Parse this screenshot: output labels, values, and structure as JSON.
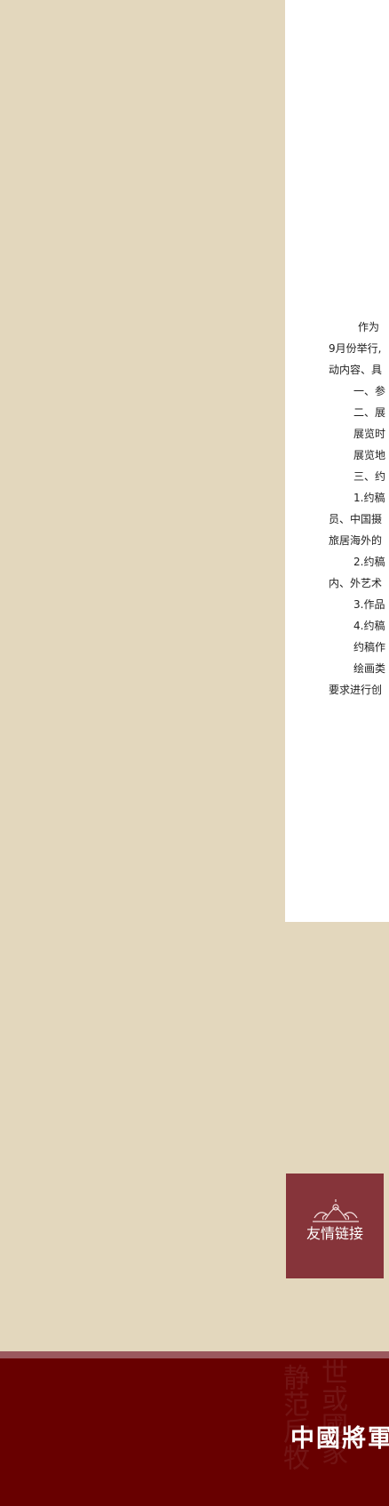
{
  "article": {
    "lines": [
      "作为",
      "9月份举行,",
      "动内容、具",
      "一、参",
      "二、展",
      "展览时",
      "展览地",
      "三、约",
      "1.约稿",
      "员、中国摄",
      "旅居海外的",
      "2.约稿",
      "内、外艺术",
      "3.作品",
      "4.约稿",
      "约稿作",
      "绘画类",
      "要求进行创"
    ]
  },
  "sidebar": {
    "friend_links_label": "友情链接"
  },
  "footer": {
    "logo_text": "中國將軍",
    "calligraphy": [
      "世或國家",
      "静范后牧"
    ]
  },
  "colors": {
    "background": "#e3d7bd",
    "panel": "#ffffff",
    "friend_box": "#86343a",
    "footer": "#680000",
    "footer_strip": "#9b595e"
  }
}
